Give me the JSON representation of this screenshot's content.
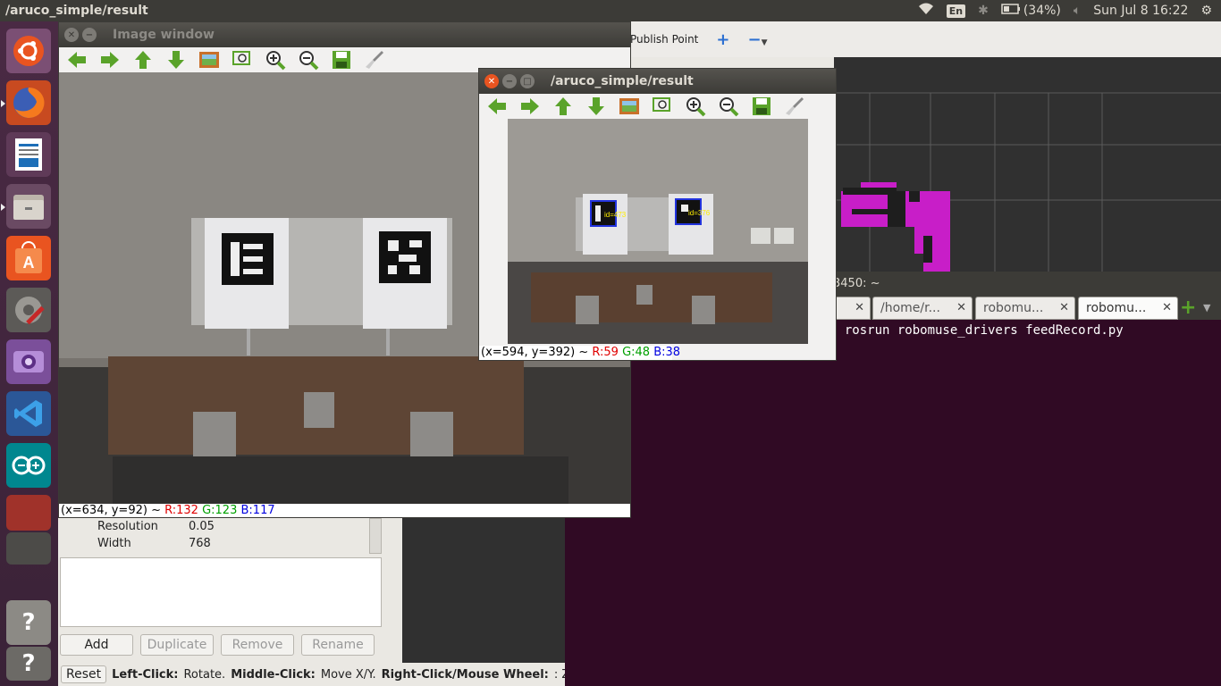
{
  "top_panel": {
    "app_title": "/aruco_simple/result",
    "lang": "En",
    "battery": "(34%)",
    "clock": "Sun Jul 8 16:22",
    "icons": [
      "wifi-icon",
      "bluetooth-icon",
      "battery-icon",
      "volume-icon",
      "gear-icon"
    ]
  },
  "launcher": {
    "items": [
      "ubuntu-icon",
      "firefox-icon",
      "writer-icon",
      "files-icon",
      "software-center-icon",
      "settings-icon",
      "camera-app-icon",
      "vscode-icon",
      "arduino-icon",
      "stacked-apps-icon",
      "stacked-apps-icon",
      "help-icon",
      "help-icon"
    ],
    "help_glyph": "?"
  },
  "rviz": {
    "toolbar": {
      "publish_point": "Publish Point"
    },
    "properties": [
      {
        "name": "Resolution",
        "value": "0.05"
      },
      {
        "name": "Width",
        "value": "768"
      }
    ],
    "buttons": {
      "add": "Add",
      "duplicate": "Duplicate",
      "remove": "Remove",
      "rename": "Rename"
    },
    "status": {
      "reset": "Reset",
      "left_click": "Left-Click:",
      "rotate": "Rotate.",
      "middle_click": "Middle-Click:",
      "move": "Move X/Y.",
      "right_click": "Right-Click/Mouse Wheel:",
      "zoom": ": Zo"
    },
    "colors": {
      "map_magenta": "#c81ec8",
      "map_dark": "#1e1e1e",
      "grid": "#5a5a5a"
    }
  },
  "terminal": {
    "title_fragment": "3450: ~",
    "tabs": [
      "",
      "/home/r...",
      "robomu...",
      "robomu..."
    ],
    "prompt_line": "$ rosrun robomuse_drivers feedRecord.py"
  },
  "image_window": {
    "title": "Image window",
    "pixel_info": {
      "coords": "(x=634, y=92) ~",
      "r": "R:132",
      "g": "G:123",
      "b": "B:117"
    }
  },
  "aruco_window": {
    "title": "/aruco_simple/result",
    "marker_labels": [
      "id=473",
      "id=376"
    ],
    "pixel_info": {
      "coords": "(x=594, y=392) ~",
      "r": "R:59",
      "g": "G:48",
      "b": "B:38"
    }
  },
  "toolbar_icons": [
    "arrow-left-icon",
    "arrow-right-icon",
    "arrow-up-icon",
    "arrow-down-icon",
    "image-icon",
    "zoom-fit-icon",
    "zoom-in-icon",
    "zoom-out-icon",
    "save-icon",
    "brush-icon"
  ]
}
